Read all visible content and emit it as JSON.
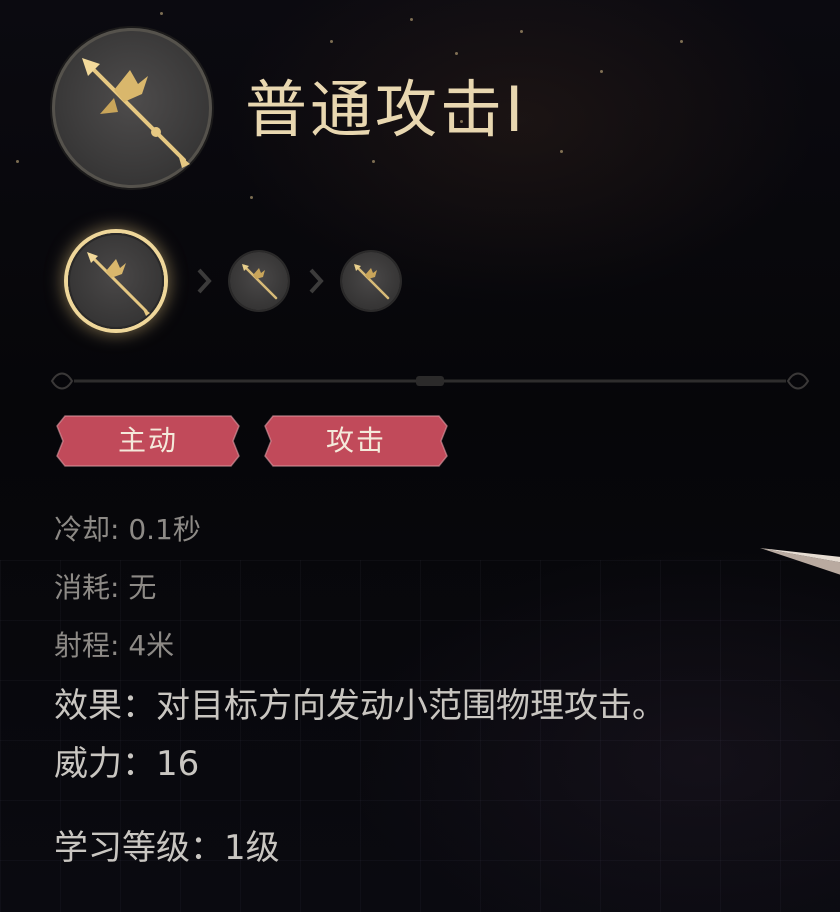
{
  "skill": {
    "name": "普通攻击I",
    "icon": "spear-icon"
  },
  "progression": {
    "nodes": [
      {
        "icon": "spear-icon",
        "state": "active"
      },
      {
        "icon": "spear-icon",
        "state": "locked"
      },
      {
        "icon": "spear-icon",
        "state": "locked"
      }
    ],
    "separator_icon": "chevron-right-icon"
  },
  "tags": [
    "主动",
    "攻击"
  ],
  "stats": {
    "cooldown": "冷却: 0.1秒",
    "cost": "消耗: 无",
    "range": "射程: 4米",
    "effect": "效果：对目标方向发动小范围物理攻击。",
    "power": "威力：16",
    "learn_level": "学习等级：1级"
  },
  "colors": {
    "title": "#e8d7b0",
    "tag_fill": "#c14a5a",
    "active_ring": "#efd79a",
    "stat_secondary": "#8d8a86",
    "stat_primary": "#c9c6c1"
  }
}
